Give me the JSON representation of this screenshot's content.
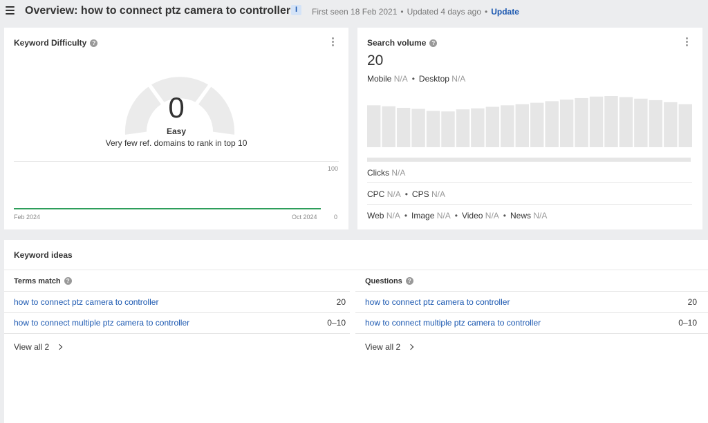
{
  "header": {
    "title": "Overview: how to connect ptz camera to controller",
    "badge": "I",
    "first_seen": "First seen 18 Feb 2021",
    "updated": "Updated 4 days ago",
    "update_label": "Update"
  },
  "kd": {
    "title": "Keyword Difficulty",
    "value": "0",
    "label": "Easy",
    "description": "Very few ref. domains to rank in top 10",
    "axis_top": "100",
    "axis_bottom": "0",
    "date_start": "Feb 2024",
    "date_end": "Oct 2024",
    "line_color": "#2e9e5b"
  },
  "sv": {
    "title": "Search volume",
    "value": "20",
    "mobile_label": "Mobile",
    "mobile_value": "N/A",
    "desktop_label": "Desktop",
    "desktop_value": "N/A",
    "bar_levels": [
      0.82,
      0.8,
      0.77,
      0.75,
      0.71,
      0.7,
      0.74,
      0.76,
      0.79,
      0.82,
      0.84,
      0.87,
      0.9,
      0.93,
      0.96,
      0.99,
      1.0,
      0.98,
      0.95,
      0.92,
      0.88,
      0.84
    ],
    "clicks_label": "Clicks",
    "clicks_value": "N/A",
    "cpc_label": "CPC",
    "cpc_value": "N/A",
    "cps_label": "CPS",
    "cps_value": "N/A",
    "web_label": "Web",
    "web_value": "N/A",
    "image_label": "Image",
    "image_value": "N/A",
    "video_label": "Video",
    "video_value": "N/A",
    "news_label": "News",
    "news_value": "N/A"
  },
  "ideas": {
    "title": "Keyword ideas",
    "terms": {
      "heading": "Terms match",
      "rows": [
        {
          "keyword": "how to connect ptz camera to controller",
          "volume": "20"
        },
        {
          "keyword": "how to connect multiple ptz camera to controller",
          "volume": "0–10"
        }
      ],
      "view_all": "View all 2"
    },
    "questions": {
      "heading": "Questions",
      "rows": [
        {
          "keyword": "how to connect ptz camera to controller",
          "volume": "20"
        },
        {
          "keyword": "how to connect multiple ptz camera to controller",
          "volume": "0–10"
        }
      ],
      "view_all": "View all 2"
    }
  }
}
